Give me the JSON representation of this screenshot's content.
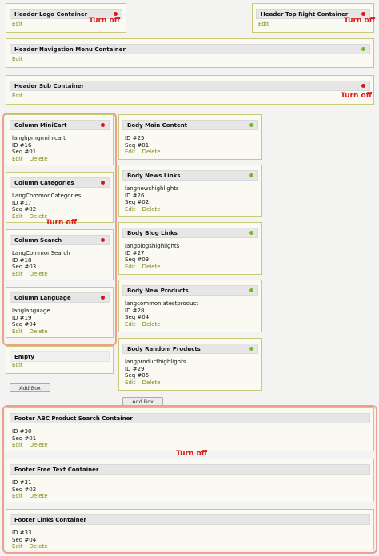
{
  "header": {
    "logo": {
      "title": "Header Logo Container",
      "edit": "Edit",
      "note": "Turn off"
    },
    "top_right": {
      "title": "Header Top Right Container",
      "edit": "Edit",
      "note": "Turn off"
    },
    "nav": {
      "title": "Header Navigation Menu Container",
      "edit": "Edit"
    },
    "sub": {
      "title": "Header Sub Container",
      "edit": "Edit",
      "note": "Turn off"
    }
  },
  "left_column": {
    "note": "Turn off",
    "boxes": [
      {
        "title": "Column MiniCart",
        "key": "langhpmgrminicart",
        "id": "ID #16",
        "seq": "Seq #01",
        "edit": "Edit",
        "delete": "Delete"
      },
      {
        "title": "Column Categories",
        "key": "LangCommonCategories",
        "id": "ID #17",
        "seq": "Seq #02",
        "edit": "Edit",
        "delete": "Delete"
      },
      {
        "title": "Column Search",
        "key": "LangCommonSearch",
        "id": "ID #18",
        "seq": "Seq #03",
        "edit": "Edit",
        "delete": "Delete"
      },
      {
        "title": "Column Language",
        "key": "langlanguage",
        "id": "ID #19",
        "seq": "Seq #04",
        "edit": "Edit",
        "delete": "Delete"
      }
    ],
    "empty": {
      "title": "Empty",
      "edit": "Edit"
    },
    "add_box": "Add Box"
  },
  "body_column": {
    "boxes": [
      {
        "title": "Body Main Content",
        "id": "ID #25",
        "seq": "Seq #01",
        "edit": "Edit",
        "delete": "Delete"
      },
      {
        "title": "Body News Links",
        "key": "langnewshighlights",
        "id": "ID #26",
        "seq": "Seq #02",
        "edit": "Edit",
        "delete": "Delete"
      },
      {
        "title": "Body Blog Links",
        "key": "langblogshighlights",
        "id": "ID #27",
        "seq": "Seq #03",
        "edit": "Edit",
        "delete": "Delete"
      },
      {
        "title": "Body New Products",
        "key": "langcommonlatestproduct",
        "id": "ID #28",
        "seq": "Seq #04",
        "edit": "Edit",
        "delete": "Delete"
      },
      {
        "title": "Body Random Products",
        "key": "langproducthighlights",
        "id": "ID #29",
        "seq": "Seq #05",
        "edit": "Edit",
        "delete": "Delete"
      }
    ],
    "add_box": "Add Box"
  },
  "footer": {
    "note": "Turn off",
    "boxes": [
      {
        "title": "Footer ABC Product Search Container",
        "id": "ID #30",
        "seq": "Seq #01",
        "edit": "Edit",
        "delete": "Delete"
      },
      {
        "title": "Footer Free Text Container",
        "id": "ID #31",
        "seq": "Seq #02",
        "edit": "Edit",
        "delete": "Delete"
      },
      {
        "title": "Footer Links Container",
        "id": "ID #33",
        "seq": "Seq #04",
        "edit": "Edit",
        "delete": "Delete"
      }
    ]
  },
  "colors": {
    "active": "#7ab62d",
    "inactive": "#d8131b",
    "annotation": "#e11818",
    "highlight": "#f0a08a",
    "link": "#7a8a14"
  }
}
